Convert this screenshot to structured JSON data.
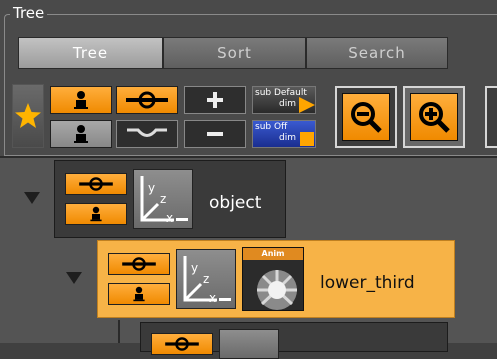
{
  "panel": {
    "title": "Tree",
    "tabs": [
      {
        "label": "Tree",
        "active": true
      },
      {
        "label": "Sort",
        "active": false
      },
      {
        "label": "Search",
        "active": false
      }
    ]
  },
  "toolbar": {
    "sub_default": {
      "line1": "sub Default",
      "line2": "dim"
    },
    "sub_off": {
      "line1": "sub Off",
      "line2": "dim"
    }
  },
  "tree": {
    "nodes": [
      {
        "label": "object",
        "selected": false
      },
      {
        "label": "lower_third",
        "selected": true,
        "plugin_label": "Anim"
      }
    ]
  },
  "colors": {
    "accent_orange": "#f7b347",
    "button_orange": "#f59a1b",
    "panel_bg": "#4a4a4a"
  }
}
